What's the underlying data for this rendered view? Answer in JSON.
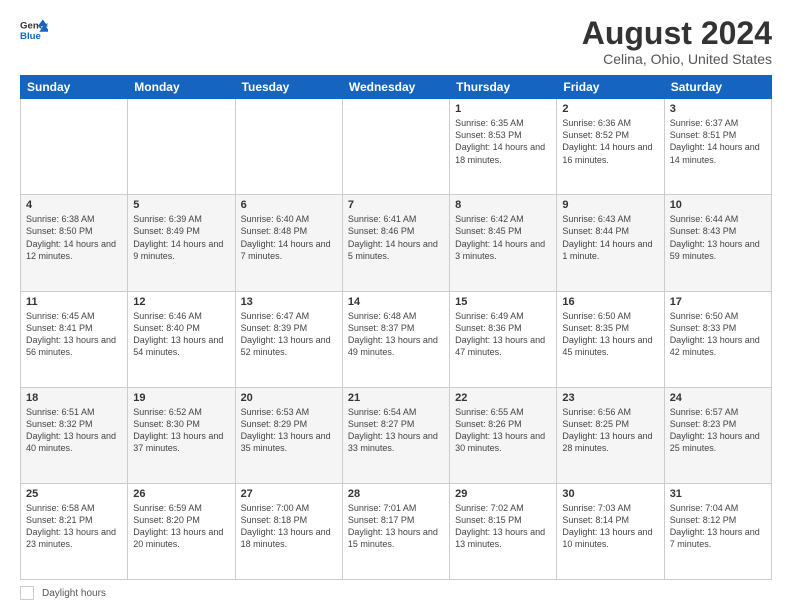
{
  "header": {
    "logo_line1": "General",
    "logo_line2": "Blue",
    "title": "August 2024",
    "subtitle": "Celina, Ohio, United States"
  },
  "days_of_week": [
    "Sunday",
    "Monday",
    "Tuesday",
    "Wednesday",
    "Thursday",
    "Friday",
    "Saturday"
  ],
  "weeks": [
    [
      {
        "day": "",
        "info": ""
      },
      {
        "day": "",
        "info": ""
      },
      {
        "day": "",
        "info": ""
      },
      {
        "day": "",
        "info": ""
      },
      {
        "day": "1",
        "info": "Sunrise: 6:35 AM\nSunset: 8:53 PM\nDaylight: 14 hours\nand 18 minutes."
      },
      {
        "day": "2",
        "info": "Sunrise: 6:36 AM\nSunset: 8:52 PM\nDaylight: 14 hours\nand 16 minutes."
      },
      {
        "day": "3",
        "info": "Sunrise: 6:37 AM\nSunset: 8:51 PM\nDaylight: 14 hours\nand 14 minutes."
      }
    ],
    [
      {
        "day": "4",
        "info": "Sunrise: 6:38 AM\nSunset: 8:50 PM\nDaylight: 14 hours\nand 12 minutes."
      },
      {
        "day": "5",
        "info": "Sunrise: 6:39 AM\nSunset: 8:49 PM\nDaylight: 14 hours\nand 9 minutes."
      },
      {
        "day": "6",
        "info": "Sunrise: 6:40 AM\nSunset: 8:48 PM\nDaylight: 14 hours\nand 7 minutes."
      },
      {
        "day": "7",
        "info": "Sunrise: 6:41 AM\nSunset: 8:46 PM\nDaylight: 14 hours\nand 5 minutes."
      },
      {
        "day": "8",
        "info": "Sunrise: 6:42 AM\nSunset: 8:45 PM\nDaylight: 14 hours\nand 3 minutes."
      },
      {
        "day": "9",
        "info": "Sunrise: 6:43 AM\nSunset: 8:44 PM\nDaylight: 14 hours\nand 1 minute."
      },
      {
        "day": "10",
        "info": "Sunrise: 6:44 AM\nSunset: 8:43 PM\nDaylight: 13 hours\nand 59 minutes."
      }
    ],
    [
      {
        "day": "11",
        "info": "Sunrise: 6:45 AM\nSunset: 8:41 PM\nDaylight: 13 hours\nand 56 minutes."
      },
      {
        "day": "12",
        "info": "Sunrise: 6:46 AM\nSunset: 8:40 PM\nDaylight: 13 hours\nand 54 minutes."
      },
      {
        "day": "13",
        "info": "Sunrise: 6:47 AM\nSunset: 8:39 PM\nDaylight: 13 hours\nand 52 minutes."
      },
      {
        "day": "14",
        "info": "Sunrise: 6:48 AM\nSunset: 8:37 PM\nDaylight: 13 hours\nand 49 minutes."
      },
      {
        "day": "15",
        "info": "Sunrise: 6:49 AM\nSunset: 8:36 PM\nDaylight: 13 hours\nand 47 minutes."
      },
      {
        "day": "16",
        "info": "Sunrise: 6:50 AM\nSunset: 8:35 PM\nDaylight: 13 hours\nand 45 minutes."
      },
      {
        "day": "17",
        "info": "Sunrise: 6:50 AM\nSunset: 8:33 PM\nDaylight: 13 hours\nand 42 minutes."
      }
    ],
    [
      {
        "day": "18",
        "info": "Sunrise: 6:51 AM\nSunset: 8:32 PM\nDaylight: 13 hours\nand 40 minutes."
      },
      {
        "day": "19",
        "info": "Sunrise: 6:52 AM\nSunset: 8:30 PM\nDaylight: 13 hours\nand 37 minutes."
      },
      {
        "day": "20",
        "info": "Sunrise: 6:53 AM\nSunset: 8:29 PM\nDaylight: 13 hours\nand 35 minutes."
      },
      {
        "day": "21",
        "info": "Sunrise: 6:54 AM\nSunset: 8:27 PM\nDaylight: 13 hours\nand 33 minutes."
      },
      {
        "day": "22",
        "info": "Sunrise: 6:55 AM\nSunset: 8:26 PM\nDaylight: 13 hours\nand 30 minutes."
      },
      {
        "day": "23",
        "info": "Sunrise: 6:56 AM\nSunset: 8:25 PM\nDaylight: 13 hours\nand 28 minutes."
      },
      {
        "day": "24",
        "info": "Sunrise: 6:57 AM\nSunset: 8:23 PM\nDaylight: 13 hours\nand 25 minutes."
      }
    ],
    [
      {
        "day": "25",
        "info": "Sunrise: 6:58 AM\nSunset: 8:21 PM\nDaylight: 13 hours\nand 23 minutes."
      },
      {
        "day": "26",
        "info": "Sunrise: 6:59 AM\nSunset: 8:20 PM\nDaylight: 13 hours\nand 20 minutes."
      },
      {
        "day": "27",
        "info": "Sunrise: 7:00 AM\nSunset: 8:18 PM\nDaylight: 13 hours\nand 18 minutes."
      },
      {
        "day": "28",
        "info": "Sunrise: 7:01 AM\nSunset: 8:17 PM\nDaylight: 13 hours\nand 15 minutes."
      },
      {
        "day": "29",
        "info": "Sunrise: 7:02 AM\nSunset: 8:15 PM\nDaylight: 13 hours\nand 13 minutes."
      },
      {
        "day": "30",
        "info": "Sunrise: 7:03 AM\nSunset: 8:14 PM\nDaylight: 13 hours\nand 10 minutes."
      },
      {
        "day": "31",
        "info": "Sunrise: 7:04 AM\nSunset: 8:12 PM\nDaylight: 13 hours\nand 7 minutes."
      }
    ]
  ],
  "legend": {
    "label": "Daylight hours"
  }
}
